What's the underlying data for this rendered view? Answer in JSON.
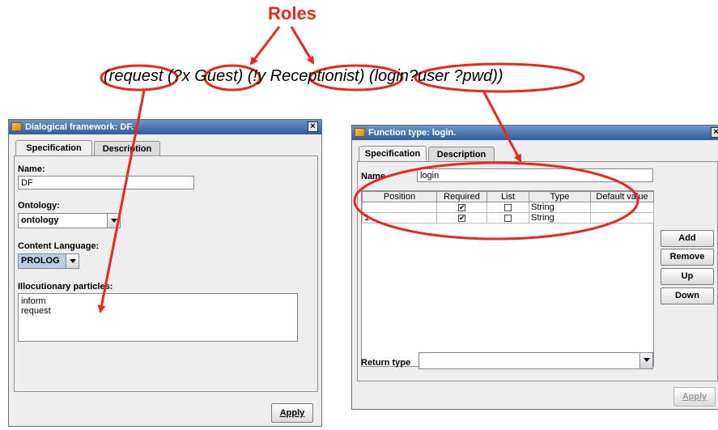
{
  "annotation": {
    "roles_label": "Roles",
    "expr": {
      "part1": "(request",
      "part2": " (?x ",
      "part3": "Guest",
      "part4": ")  (!y ",
      "part5": "Receptionist",
      "part6": ") ",
      "part7": "(login?user ?pwd))"
    },
    "accent": "#e8281a"
  },
  "dialog_left": {
    "title": "Dialogical framework: DF.",
    "close": "×",
    "tabs": [
      "Specification",
      "Description"
    ],
    "name_label": "Name:",
    "name_value": "DF",
    "ontology_label": "Ontology:",
    "ontology_value": "ontology",
    "content_language_label": "Content Language:",
    "content_language_value": "PROLOG",
    "particles_label": "Illocutionary particles:",
    "particles": [
      "inform",
      "request"
    ],
    "apply_label": "Apply"
  },
  "dialog_right": {
    "title": "Function type: login.",
    "close": "×",
    "tabs": [
      "Specification",
      "Description"
    ],
    "name_label": "Name",
    "name_value": "login",
    "columns": [
      "Position",
      "Required",
      "List",
      "Type",
      "Default value"
    ],
    "rows": [
      {
        "position": "",
        "required": true,
        "list": false,
        "type": "String",
        "default": ""
      },
      {
        "position": "1",
        "required": true,
        "list": false,
        "type": "String",
        "default": ""
      }
    ],
    "buttons": {
      "add": "Add",
      "remove": "Remove",
      "up": "Up",
      "down": "Down"
    },
    "return_type_label": "Return type",
    "apply_label": "Apply"
  }
}
